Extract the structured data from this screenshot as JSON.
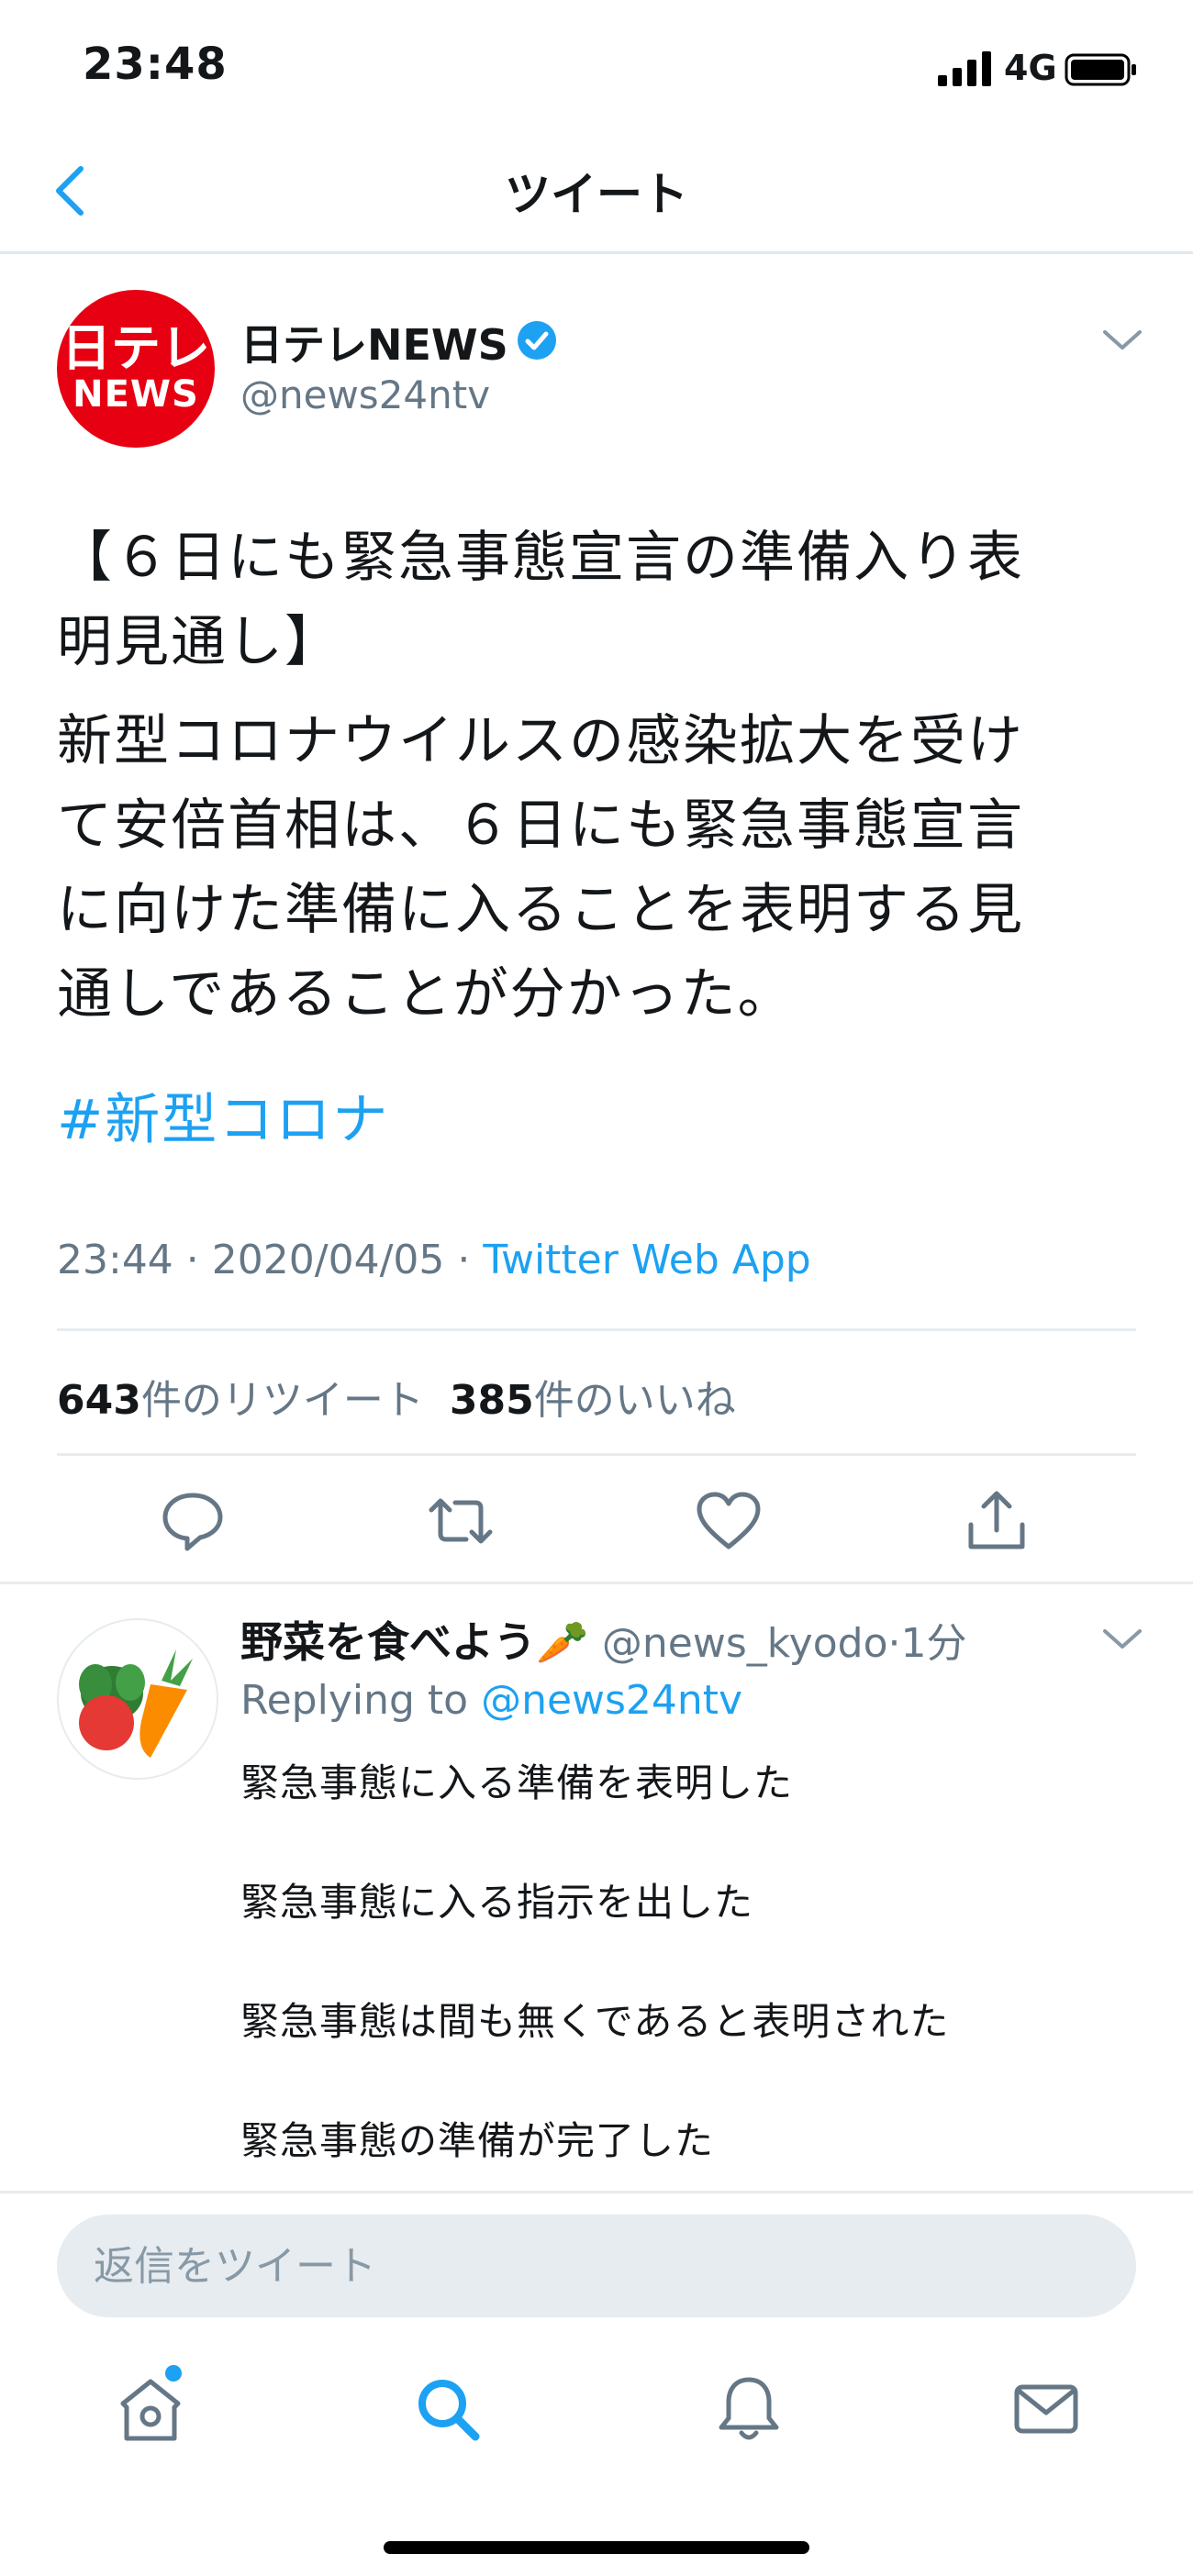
{
  "status_bar": {
    "time": "23:48",
    "network": "4G"
  },
  "nav": {
    "title": "ツイート"
  },
  "tweet": {
    "author_logo": {
      "line1": "日テレ",
      "line2": "NEWS"
    },
    "author_name": "日テレNEWS",
    "author_handle": "@news24ntv",
    "text_lines": [
      "【６日にも緊急事態宣言の準備入り表",
      "明見通し】",
      "新型コロナウイルスの感染拡大を受け",
      "て安倍首相は、６日にも緊急事態宣言",
      "に向けた準備に入ることを表明する見",
      "通しであることが分かった。"
    ],
    "hashtag": "#新型コロナ",
    "time": "23:44",
    "date": "2020/04/05",
    "separator": " · ",
    "source": "Twitter Web App",
    "retweet_count": "643",
    "retweet_label": "件のリツイート",
    "like_count": "385",
    "like_label": "件のいいね"
  },
  "reply": {
    "name": "野菜を食べよう🥕",
    "handle": "@news_kyodo",
    "time": "·1分",
    "replying_label": "Replying to",
    "replying_handle": "@news24ntv",
    "lines": [
      "緊急事態に入る準備を表明した",
      "緊急事態に入る指示を出した",
      "緊急事態は間も無くであると表明された",
      "緊急事態の準備が完了した"
    ]
  },
  "reply_box": {
    "placeholder": "返信をツイート"
  },
  "colors": {
    "accent": "#1da1f2",
    "brand_red": "#e60012",
    "secondary_text": "#657786"
  }
}
